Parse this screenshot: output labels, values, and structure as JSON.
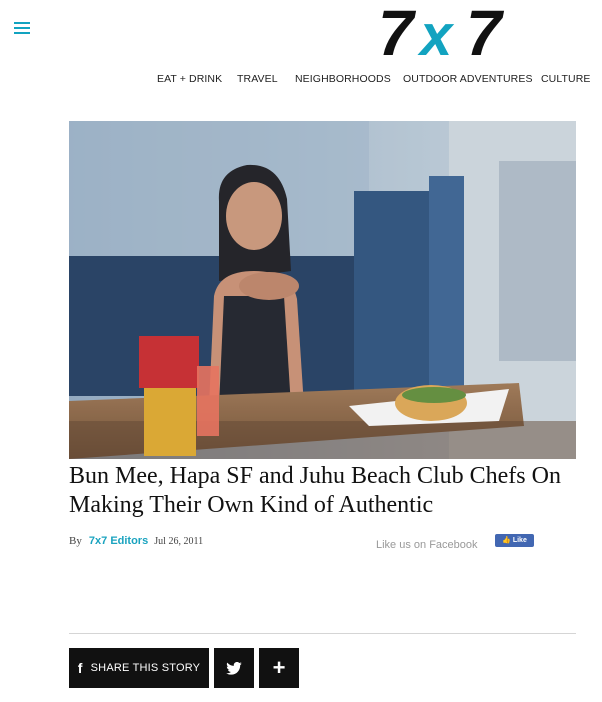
{
  "header": {
    "logo_text": "7x7",
    "logo_colors": {
      "seven": "#111111",
      "x": "#12a3c0"
    },
    "menu_icon": "hamburger-icon"
  },
  "nav": {
    "items": [
      "EAT + DRINK",
      "TRAVEL",
      "NEIGHBORHOODS",
      "OUTDOOR ADVENTURES",
      "CULTURE"
    ]
  },
  "article": {
    "headline": "Bun Mee, Hapa SF and Juhu Beach Club Chefs On Making Their Own Kind of Authentic",
    "by_label": "By",
    "author": "7x7 Editors",
    "date": "Jul 26, 2011",
    "like_us_text": "Like us on Facebook",
    "fb_like_label": "Like"
  },
  "share": {
    "share_label": "SHARE THIS STORY",
    "facebook_icon": "f",
    "twitter_icon": "twitter-icon",
    "more_icon": "+"
  },
  "colors": {
    "accent": "#12a3c0",
    "button_bg": "#111111",
    "facebook_blue": "#4267b2"
  }
}
